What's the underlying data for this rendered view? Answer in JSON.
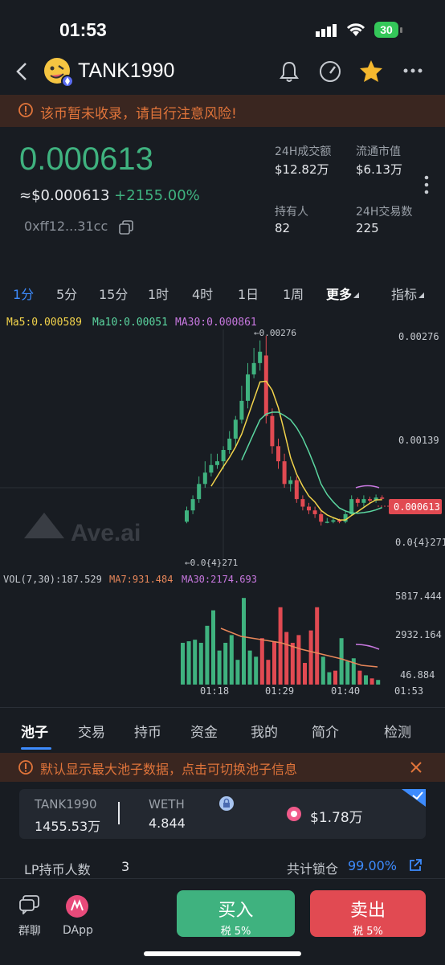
{
  "status": {
    "time": "01:53",
    "battery": "30"
  },
  "header": {
    "token_name": "TANK1990"
  },
  "warning": {
    "text": "该币暂未收录，请自行注意风险!"
  },
  "price": {
    "value": "0.000613",
    "usd": "≈$0.000613",
    "change": "+2155.00%",
    "address": "0xff12...31cc"
  },
  "stats": {
    "volume_label": "24H成交额",
    "volume_value": "$12.82万",
    "mcap_label": "流通市值",
    "mcap_value": "$6.13万",
    "holders_label": "持有人",
    "holders_value": "82",
    "tx_label": "24H交易数",
    "tx_value": "225"
  },
  "timeframes": [
    "1分",
    "5分",
    "15分",
    "1时",
    "4时",
    "1日",
    "1周",
    "更多",
    "指标"
  ],
  "chart_data": {
    "type": "candlestick",
    "ma": {
      "ma5": "Ma5:0.000589",
      "ma10": "Ma10:0.00051",
      "ma30": "MA30:0.000861"
    },
    "y_ticks": [
      "0.00276",
      "0.00139",
      "0.0{4}271"
    ],
    "high_marker": "←0.00276",
    "low_marker": "←0.0{4}271",
    "current_price_tag": "0.000613",
    "watermark": "Ave.ai",
    "volume": {
      "label": "VOL(7,30):187.529",
      "ma7": "MA7:931.484",
      "ma30": "MA30:2174.693",
      "y_ticks": [
        "5817.444",
        "2932.164",
        "46.884"
      ]
    },
    "x_ticks": [
      "01:18",
      "01:29",
      "01:40",
      "01:53"
    ],
    "candles": [
      {
        "o": 0.0003,
        "c": 0.00045,
        "h": 0.0005,
        "l": 0.00028,
        "up": true
      },
      {
        "o": 0.00045,
        "c": 0.0006,
        "h": 0.00065,
        "l": 0.0004,
        "up": true
      },
      {
        "o": 0.0006,
        "c": 0.0008,
        "h": 0.0009,
        "l": 0.00055,
        "up": true
      },
      {
        "o": 0.0008,
        "c": 0.00095,
        "h": 0.0011,
        "l": 0.00075,
        "up": true
      },
      {
        "o": 0.00095,
        "c": 0.00105,
        "h": 0.0012,
        "l": 0.0009,
        "up": true
      },
      {
        "o": 0.00105,
        "c": 0.0011,
        "h": 0.0012,
        "l": 0.001,
        "up": true
      },
      {
        "o": 0.0011,
        "c": 0.00125,
        "h": 0.0013,
        "l": 0.001,
        "up": true
      },
      {
        "o": 0.00125,
        "c": 0.0014,
        "h": 0.0015,
        "l": 0.0012,
        "up": true
      },
      {
        "o": 0.0014,
        "c": 0.00165,
        "h": 0.0017,
        "l": 0.0013,
        "up": true
      },
      {
        "o": 0.00165,
        "c": 0.0019,
        "h": 0.0021,
        "l": 0.0016,
        "up": true
      },
      {
        "o": 0.0019,
        "c": 0.00225,
        "h": 0.0024,
        "l": 0.0018,
        "up": true
      },
      {
        "o": 0.00225,
        "c": 0.0024,
        "h": 0.0026,
        "l": 0.0022,
        "up": true
      },
      {
        "o": 0.0024,
        "c": 0.00255,
        "h": 0.0027,
        "l": 0.0023,
        "up": true
      },
      {
        "o": 0.0025,
        "c": 0.0017,
        "h": 0.00276,
        "l": 0.0016,
        "up": false
      },
      {
        "o": 0.0017,
        "c": 0.0013,
        "h": 0.0018,
        "l": 0.0012,
        "up": false
      },
      {
        "o": 0.0013,
        "c": 0.0011,
        "h": 0.0014,
        "l": 0.001,
        "up": false
      },
      {
        "o": 0.0011,
        "c": 0.0008,
        "h": 0.0012,
        "l": 0.00075,
        "up": false
      },
      {
        "o": 0.0008,
        "c": 0.00085,
        "h": 0.0009,
        "l": 0.0007,
        "up": true
      },
      {
        "o": 0.00085,
        "c": 0.0006,
        "h": 0.0009,
        "l": 0.00055,
        "up": false
      },
      {
        "o": 0.0006,
        "c": 0.0005,
        "h": 0.00065,
        "l": 0.00045,
        "up": false
      },
      {
        "o": 0.0005,
        "c": 0.00045,
        "h": 0.00055,
        "l": 0.0004,
        "up": false
      },
      {
        "o": 0.00045,
        "c": 0.0004,
        "h": 0.0005,
        "l": 0.00035,
        "up": false
      },
      {
        "o": 0.0004,
        "c": 0.0003,
        "h": 0.00045,
        "l": 0.00025,
        "up": false
      },
      {
        "o": 0.0003,
        "c": 0.0003,
        "h": 0.00035,
        "l": 0.00028,
        "up": true
      },
      {
        "o": 0.0003,
        "c": 0.00032,
        "h": 0.00036,
        "l": 0.00028,
        "up": true
      },
      {
        "o": 0.00032,
        "c": 0.0003,
        "h": 0.00034,
        "l": 0.00028,
        "up": false
      },
      {
        "o": 0.0003,
        "c": 0.0004,
        "h": 0.00045,
        "l": 0.00028,
        "up": true
      },
      {
        "o": 0.0004,
        "c": 0.0006,
        "h": 0.00065,
        "l": 0.00038,
        "up": true
      },
      {
        "o": 0.0006,
        "c": 0.00055,
        "h": 0.00062,
        "l": 0.0005,
        "up": false
      },
      {
        "o": 0.00055,
        "c": 0.0006,
        "h": 0.00065,
        "l": 0.0005,
        "up": true
      },
      {
        "o": 0.0006,
        "c": 0.00058,
        "h": 0.00063,
        "l": 0.00055,
        "up": false
      },
      {
        "o": 0.00058,
        "c": 0.00062,
        "h": 0.00066,
        "l": 0.00055,
        "up": true
      },
      {
        "o": 0.00062,
        "c": 0.000613,
        "h": 0.00065,
        "l": 0.0006,
        "up": false
      }
    ],
    "volumes": [
      {
        "v": 2700,
        "up": true
      },
      {
        "v": 2800,
        "up": true
      },
      {
        "v": 2900,
        "up": true
      },
      {
        "v": 2700,
        "up": true
      },
      {
        "v": 3800,
        "up": true
      },
      {
        "v": 4800,
        "up": true
      },
      {
        "v": 2200,
        "up": true
      },
      {
        "v": 2700,
        "up": true
      },
      {
        "v": 3200,
        "up": true
      },
      {
        "v": 1600,
        "up": true
      },
      {
        "v": 5600,
        "up": true
      },
      {
        "v": 2200,
        "up": true
      },
      {
        "v": 1800,
        "up": true
      },
      {
        "v": 3000,
        "up": false
      },
      {
        "v": 1600,
        "up": false
      },
      {
        "v": 2800,
        "up": false
      },
      {
        "v": 5000,
        "up": false
      },
      {
        "v": 3400,
        "up": false
      },
      {
        "v": 2700,
        "up": false
      },
      {
        "v": 3200,
        "up": false
      },
      {
        "v": 1400,
        "up": false
      },
      {
        "v": 3500,
        "up": false
      },
      {
        "v": 5000,
        "up": false
      },
      {
        "v": 1800,
        "up": true
      },
      {
        "v": 800,
        "up": true
      },
      {
        "v": 900,
        "up": false
      },
      {
        "v": 3000,
        "up": true
      },
      {
        "v": 1500,
        "up": true
      },
      {
        "v": 1700,
        "up": true
      },
      {
        "v": 900,
        "up": false
      },
      {
        "v": 600,
        "up": true
      },
      {
        "v": 400,
        "up": false
      },
      {
        "v": 300,
        "up": true
      }
    ]
  },
  "tabs": [
    "池子",
    "交易",
    "持币",
    "资金",
    "我的",
    "简介",
    "检测"
  ],
  "info": {
    "text": "默认显示最大池子数据，点击可切换池子信息"
  },
  "pool": {
    "token_a": "TANK1990",
    "token_a_amount": "1455.53万",
    "token_b": "WETH",
    "token_b_amount": "4.844",
    "liquidity": "$1.78万"
  },
  "lp": {
    "label": "LP持币人数",
    "count": "3",
    "lock_label": "共计锁仓",
    "lock_value": "99.00%"
  },
  "bottom": {
    "chat": "群聊",
    "dapp": "DApp",
    "buy": "买入",
    "buy_tax": "税 5%",
    "sell": "卖出",
    "sell_tax": "税 5%"
  },
  "colors": {
    "up": "#3fb27f",
    "down": "#e14a52",
    "accent": "#3d8bfd",
    "warn": "#e0743a"
  }
}
